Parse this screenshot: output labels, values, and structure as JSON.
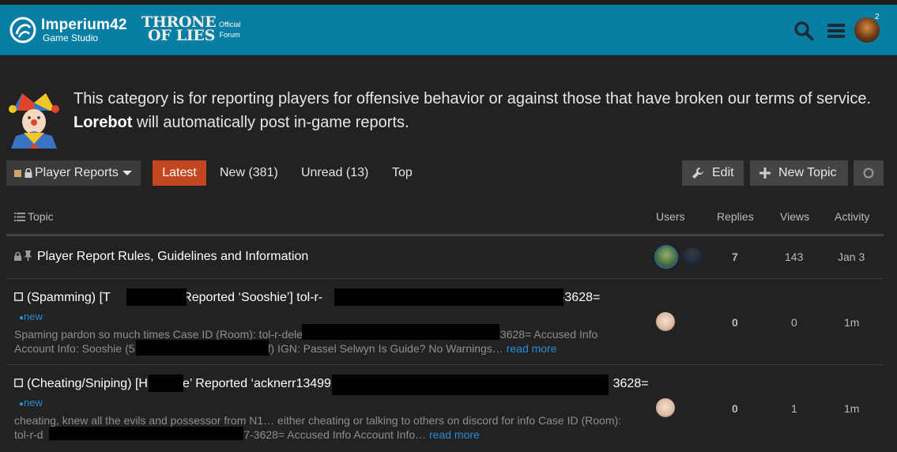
{
  "header": {
    "brand_line1": "Imperium42",
    "brand_line2": "Game Studio",
    "game_logo_line1": "THRONE",
    "game_logo_line2": "OF LIES",
    "official": "Official",
    "forum": "Forum",
    "notification_count": "2",
    "icons": [
      "search-icon",
      "menu-icon"
    ]
  },
  "category": {
    "desc_before": "This category is for reporting players for offensive behavior or against those that have broken our terms of service. ",
    "desc_bold": "Lorebot",
    "desc_after": " will automatically post in-game reports."
  },
  "nav": {
    "category_name": "Player Reports",
    "latest": "Latest",
    "new": "New (381)",
    "unread": "Unread (13)",
    "top": "Top",
    "edit": "Edit",
    "new_topic": "New Topic"
  },
  "table": {
    "headers": {
      "topic": "Topic",
      "users": "Users",
      "replies": "Replies",
      "views": "Views",
      "activity": "Activity"
    },
    "rows": [
      {
        "title": "Player Report Rules, Guidelines and Information",
        "replies": "7",
        "views": "143",
        "activity": "Jan 3"
      },
      {
        "title_a": "(Spamming) [T",
        "title_b": "s’ Reported ‘Sooshie’] tol-r-",
        "title_c": "7-3628=",
        "badge": "new",
        "excerpt1_a": "Spaming pardon so much times Case ID (Room): tol-r-dele",
        "excerpt1_b": "3628= Accused Info",
        "excerpt2_a": "Account Info: Sooshie (5",
        "excerpt2_b": "f) IGN: Passel Selwyn Is Guide? No Warnings…",
        "read_more": "read more",
        "replies": "0",
        "views": "0",
        "activity": "1m"
      },
      {
        "title_a": "(Cheating/Sniping) [H",
        "title_b": "e’ Reported ‘acknerr13499’] tol-r-del",
        "title_c": "3628=",
        "badge": "new",
        "excerpt1_a": "cheating, knew all the evils and possessor from N1… either cheating or talking to others on discord for info Case ID (Room):",
        "excerpt2_a": "tol-r-d",
        "excerpt2_b": "77-3628= Accused Info Account Info…",
        "read_more": "read more",
        "replies": "0",
        "views": "1",
        "activity": "1m"
      }
    ]
  }
}
